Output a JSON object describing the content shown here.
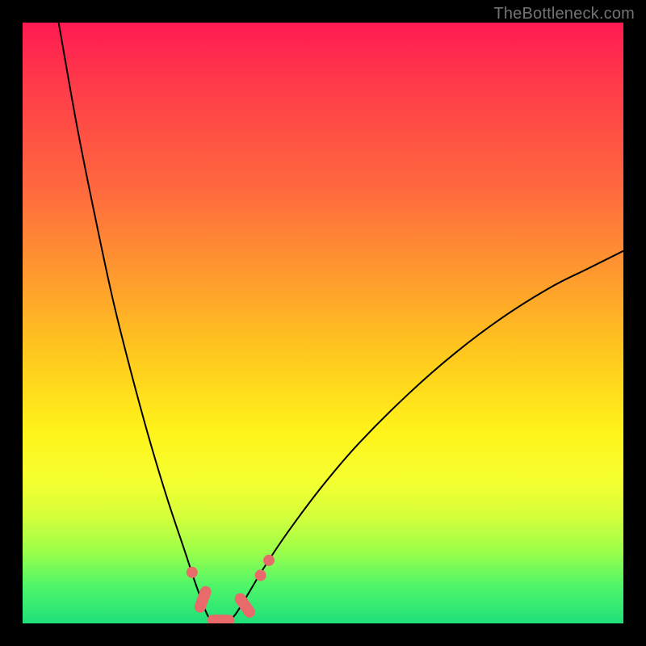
{
  "watermark": "TheBottleneck.com",
  "colors": {
    "frame": "#000000",
    "watermark_text": "#737373",
    "marker": "#e86a6a",
    "curve": "#000000",
    "gradient_stops": [
      "#ff1a52",
      "#ff3a4a",
      "#ff6a3e",
      "#ff9a2e",
      "#ffc81e",
      "#fff31a",
      "#f6ff30",
      "#d6ff3a",
      "#9cff4a",
      "#4cf56a",
      "#1fe07a"
    ]
  },
  "chart_data": {
    "type": "line",
    "title": "",
    "xlabel": "",
    "ylabel": "",
    "xlim": [
      0,
      1
    ],
    "ylim": [
      0,
      1
    ],
    "note": "Axes are implied (no tick labels shown). Values are fractions of the plot area: x left→right, y bottom→top. The curve is a V-shaped well with minimum ≈0 near x≈0.33; both arms rise steeply, the left arm reaching y≈1 near x≈0.06 and the right arm reaching y≈0.62 at x=1.",
    "series": [
      {
        "name": "bottleneck-curve",
        "x": [
          0.06,
          0.09,
          0.12,
          0.15,
          0.18,
          0.21,
          0.24,
          0.27,
          0.29,
          0.31,
          0.33,
          0.35,
          0.37,
          0.4,
          0.44,
          0.5,
          0.56,
          0.64,
          0.72,
          0.8,
          0.88,
          0.94,
          1.0
        ],
        "y": [
          1.0,
          0.83,
          0.68,
          0.54,
          0.42,
          0.31,
          0.21,
          0.12,
          0.06,
          0.01,
          0.0,
          0.01,
          0.04,
          0.09,
          0.15,
          0.23,
          0.3,
          0.38,
          0.45,
          0.51,
          0.56,
          0.59,
          0.62
        ]
      }
    ],
    "markers": [
      {
        "shape": "circle",
        "x": 0.282,
        "y": 0.085
      },
      {
        "shape": "pill",
        "x": 0.3,
        "y": 0.04,
        "angle_deg": -70
      },
      {
        "shape": "pill",
        "x": 0.33,
        "y": 0.005,
        "angle_deg": 0
      },
      {
        "shape": "pill",
        "x": 0.37,
        "y": 0.03,
        "angle_deg": 55
      },
      {
        "shape": "circle",
        "x": 0.396,
        "y": 0.08
      },
      {
        "shape": "circle",
        "x": 0.41,
        "y": 0.105
      }
    ]
  }
}
